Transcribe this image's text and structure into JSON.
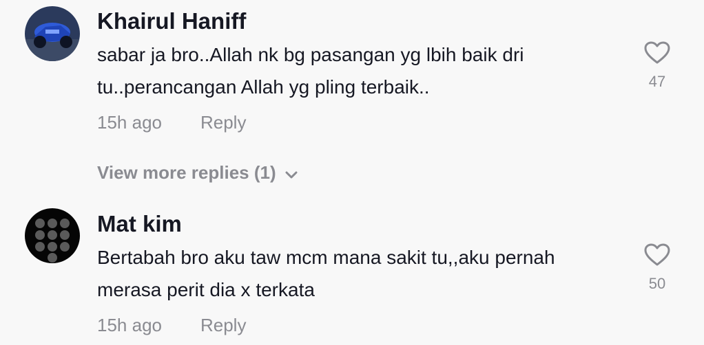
{
  "comments": [
    {
      "username": "Khairul Haniff",
      "text": "sabar ja bro..Allah nk bg pasangan yg lbih baik dri tu..perancangan Allah yg pling terbaik..",
      "time": "15h ago",
      "reply_label": "Reply",
      "likes": "47",
      "like_icon": "heart-outline-icon"
    },
    {
      "username": "Mat kim",
      "text": "Bertabah bro aku taw mcm mana sakit tu,,aku pernah merasa perit dia x terkata",
      "time": "15h ago",
      "reply_label": "Reply",
      "likes": "50",
      "like_icon": "heart-outline-icon"
    }
  ],
  "view_more": {
    "label": "View more replies (1)",
    "icon": "chevron-down-icon"
  },
  "colors": {
    "background": "#f8f8f8",
    "text_primary": "#161823",
    "text_secondary": "#8a8b91"
  }
}
